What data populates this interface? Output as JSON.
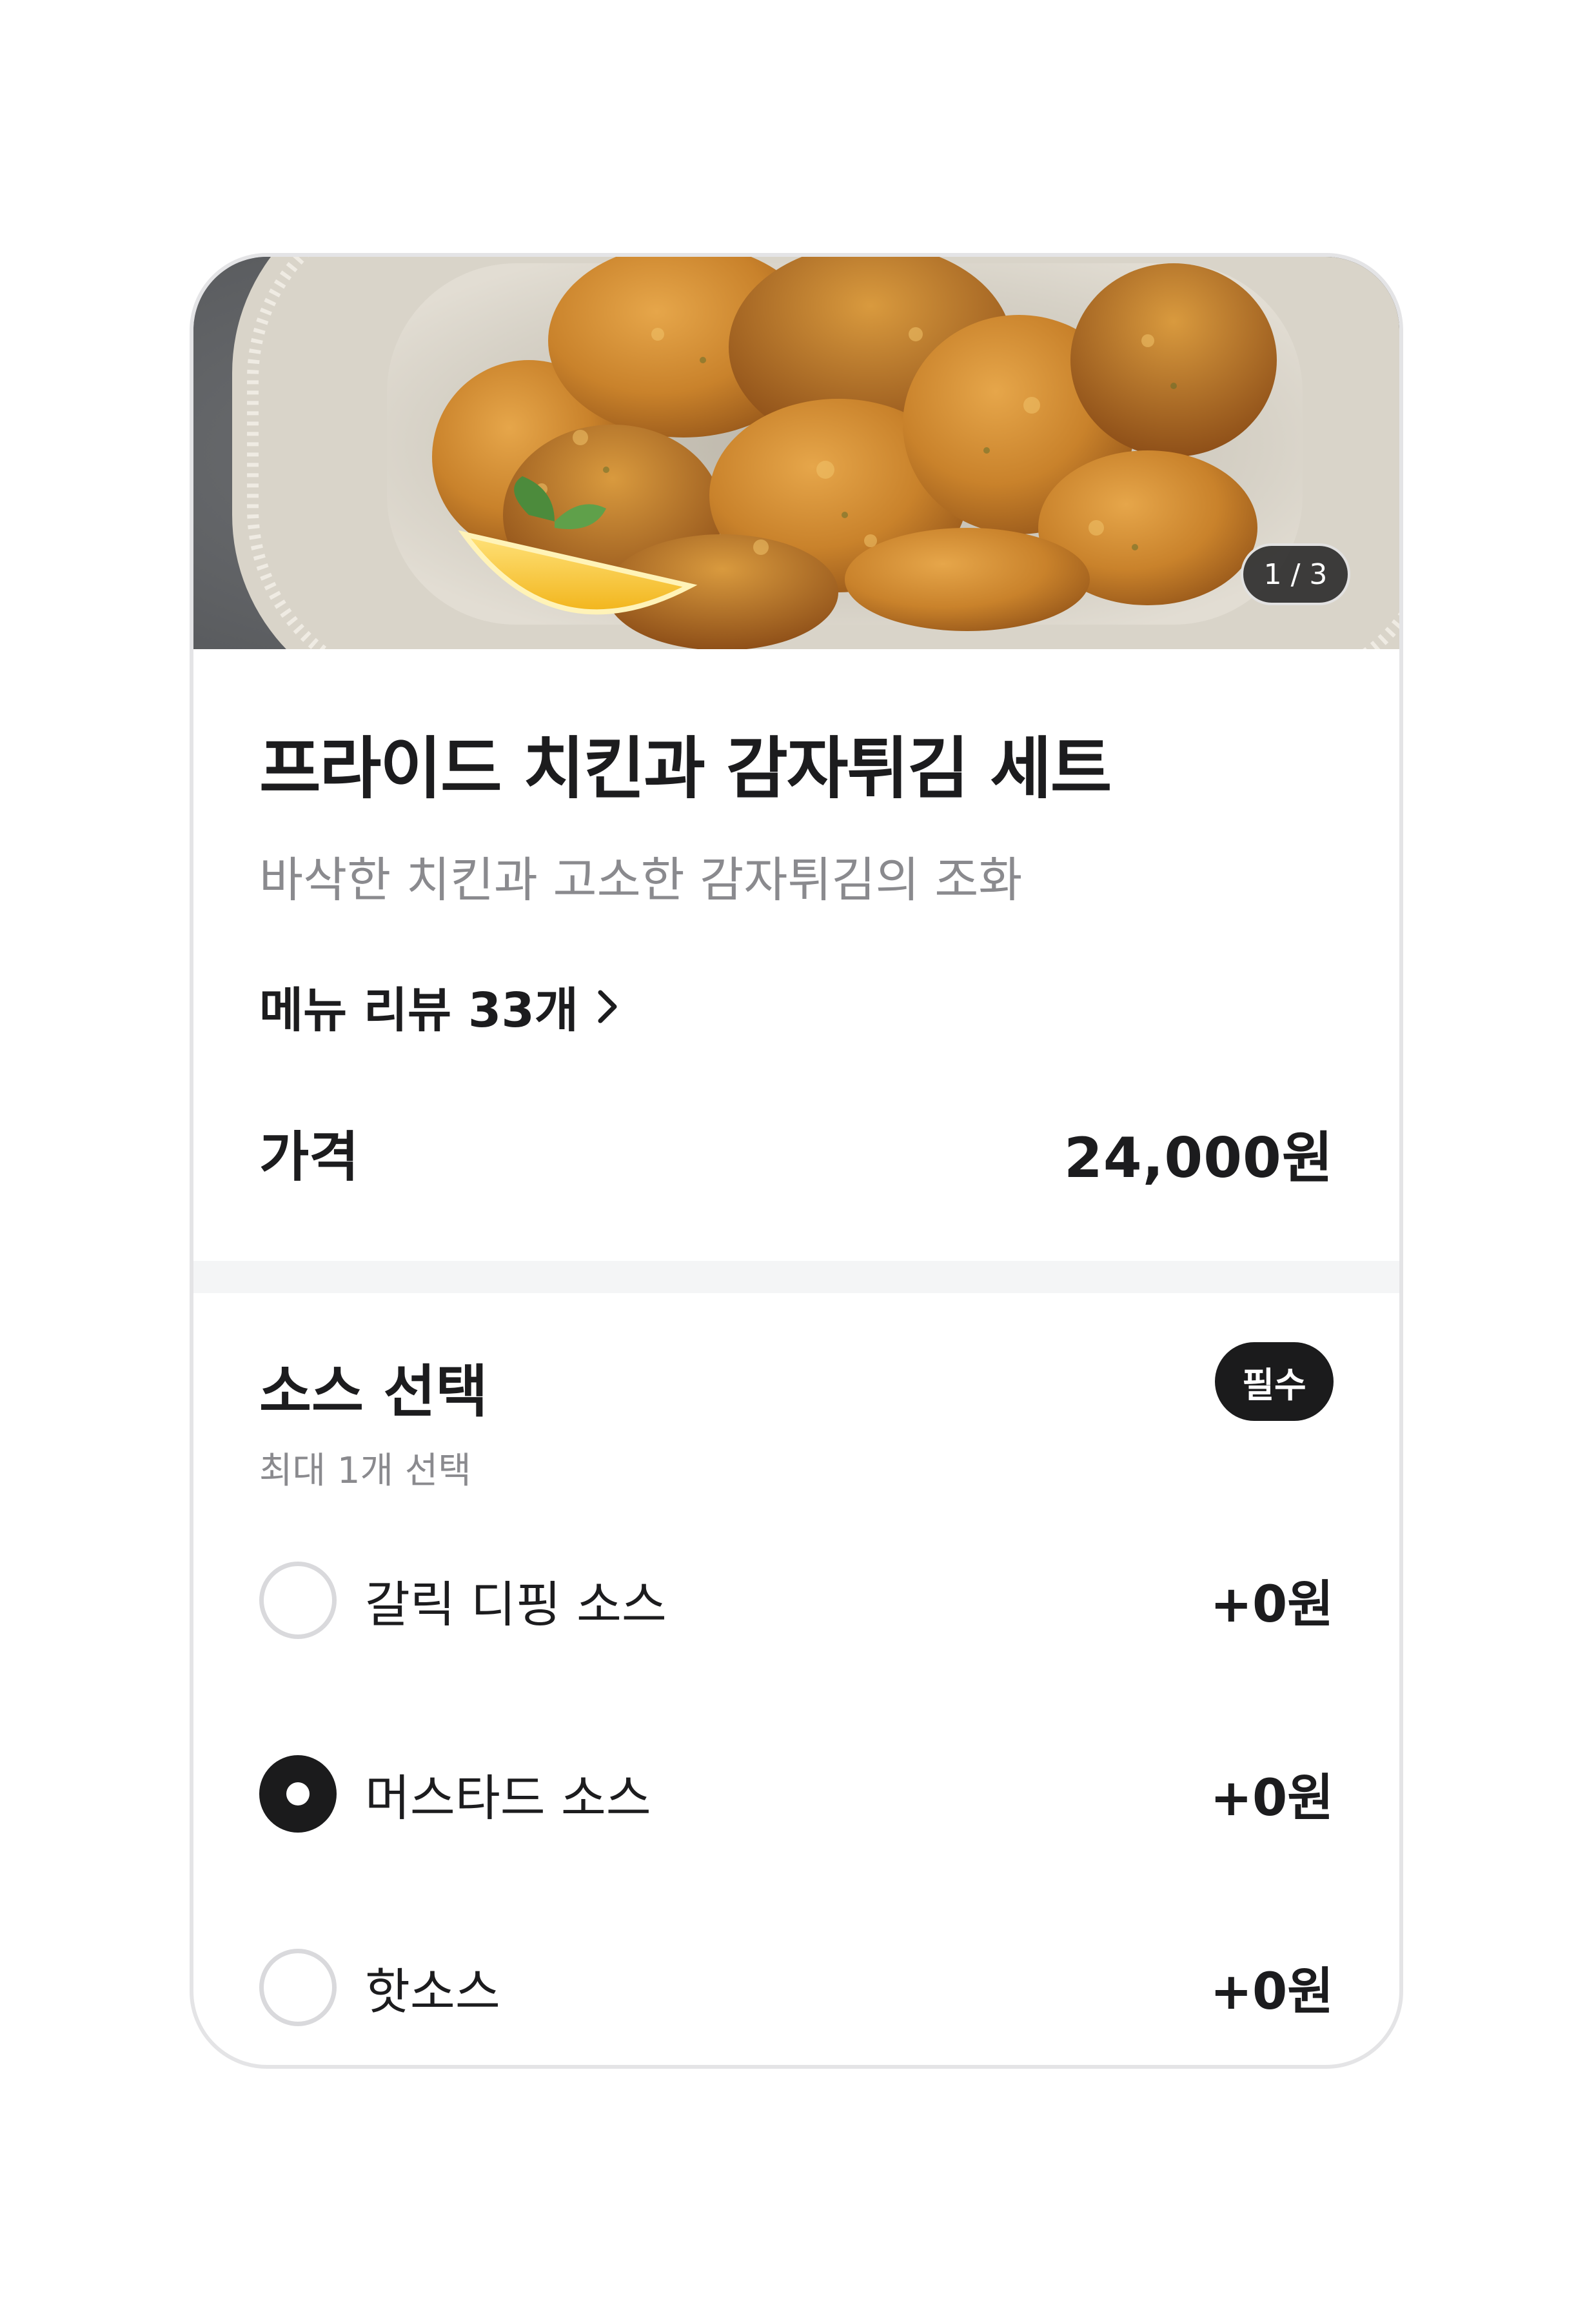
{
  "menu": {
    "image_indicator": "1 / 3",
    "title": "프라이드 치킨과 감자튀김 세트",
    "description": "바삭한 치킨과 고소한 감자튀김의 조화",
    "review_link_label": "메뉴 리뷰 33개",
    "price_label": "가격",
    "price_value": "24,000원"
  },
  "sauce_options": {
    "title": "소스 선택",
    "required_badge": "필수",
    "subtitle": "최대 1개 선택",
    "selected_index": 1,
    "items": [
      {
        "name": "갈릭 디핑 소스",
        "price": "+0원",
        "checked": false
      },
      {
        "name": "머스타드 소스",
        "price": "+0원",
        "checked": true
      },
      {
        "name": "핫소스",
        "price": "+0원",
        "checked": false
      }
    ]
  },
  "colors": {
    "text_primary": "#1c1c1e",
    "text_secondary": "#8a8a8e",
    "badge_bg": "#1b1b1c",
    "radio_border": "#d9d9dc",
    "card_border": "#e4e4e6",
    "section_divider": "#f4f5f6"
  }
}
